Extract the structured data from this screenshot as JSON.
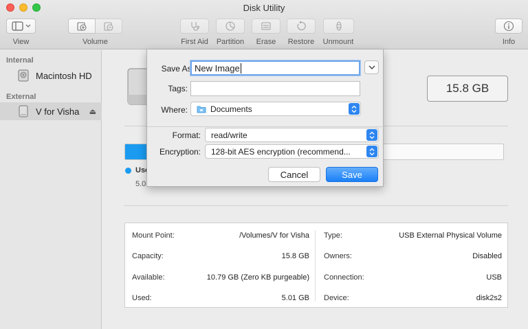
{
  "window": {
    "title": "Disk Utility"
  },
  "toolbar": {
    "view_label": "View",
    "volume_label": "Volume",
    "first_aid_label": "First Aid",
    "partition_label": "Partition",
    "erase_label": "Erase",
    "restore_label": "Restore",
    "unmount_label": "Unmount",
    "info_label": "Info"
  },
  "sidebar": {
    "internal_heading": "Internal",
    "external_heading": "External",
    "items": [
      {
        "label": "Macintosh HD",
        "icon": "internal-disk-icon"
      },
      {
        "label": "V for Visha",
        "icon": "external-disk-icon",
        "selected": true,
        "eject": "⏏"
      }
    ]
  },
  "main": {
    "capacity_display": "15.8 GB",
    "usage": {
      "legend_name": "Use",
      "legend_value": "5.0",
      "used_fraction": 0.32,
      "color": "#1a9bf0"
    },
    "info_left": [
      {
        "key": "Mount Point:",
        "value": "/Volumes/V for Visha"
      },
      {
        "key": "Capacity:",
        "value": "15.8 GB"
      },
      {
        "key": "Available:",
        "value": "10.79 GB (Zero KB purgeable)"
      },
      {
        "key": "Used:",
        "value": "5.01 GB"
      }
    ],
    "info_right": [
      {
        "key": "Type:",
        "value": "USB External Physical Volume"
      },
      {
        "key": "Owners:",
        "value": "Disabled"
      },
      {
        "key": "Connection:",
        "value": "USB"
      },
      {
        "key": "Device:",
        "value": "disk2s2"
      }
    ]
  },
  "sheet": {
    "save_as_label": "Save As:",
    "save_as_value": "New Image",
    "tags_label": "Tags:",
    "tags_value": "",
    "where_label": "Where:",
    "where_value": "Documents",
    "format_label": "Format:",
    "format_value": "read/write",
    "encryption_label": "Encryption:",
    "encryption_value": "128-bit AES encryption (recommend...",
    "cancel_label": "Cancel",
    "save_label": "Save",
    "accent_color": "#2e86f0"
  }
}
